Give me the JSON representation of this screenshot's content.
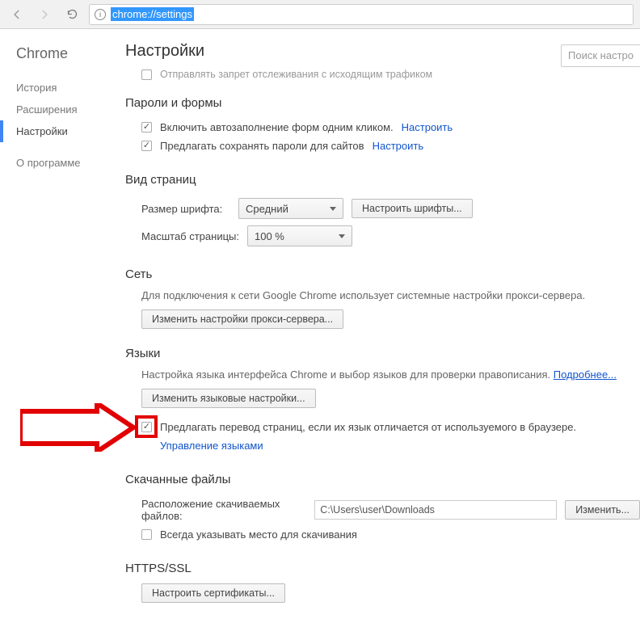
{
  "toolbar": {
    "url": "chrome://settings"
  },
  "sidebar": {
    "brand": "Chrome",
    "items": [
      {
        "label": "История",
        "active": false
      },
      {
        "label": "Расширения",
        "active": false
      },
      {
        "label": "Настройки",
        "active": true
      }
    ],
    "about": "О программе"
  },
  "header": {
    "title": "Настройки",
    "search_placeholder": "Поиск настро"
  },
  "truncated_top": {
    "label": "Отправлять запрет отслеживания с исходящим трафиком"
  },
  "passwords": {
    "title": "Пароли и формы",
    "autofill": "Включить автозаполнение форм одним кликом.",
    "autofill_link": "Настроить",
    "save_pw": "Предлагать сохранять пароли для сайтов",
    "save_pw_link": "Настроить"
  },
  "pageview": {
    "title": "Вид страниц",
    "font_label": "Размер шрифта:",
    "font_value": "Средний",
    "font_btn": "Настроить шрифты...",
    "zoom_label": "Масштаб страницы:",
    "zoom_value": "100 %"
  },
  "network": {
    "title": "Сеть",
    "desc": "Для подключения к сети Google Chrome использует системные настройки прокси-сервера.",
    "btn": "Изменить настройки прокси-сервера..."
  },
  "languages": {
    "title": "Языки",
    "desc": "Настройка языка интерфейса Chrome и выбор языков для проверки правописания.",
    "more": "Подробнее...",
    "btn": "Изменить языковые настройки...",
    "offer_translate": "Предлагать перевод страниц, если их язык отличается от используемого в браузере.",
    "manage": "Управление языками"
  },
  "downloads": {
    "title": "Скачанные файлы",
    "loc_label": "Расположение скачиваемых файлов:",
    "loc_value": "C:\\Users\\user\\Downloads",
    "change_btn": "Изменить...",
    "ask_label": "Всегда указывать место для скачивания"
  },
  "https": {
    "title": "HTTPS/SSL",
    "btn": "Настроить сертификаты..."
  }
}
